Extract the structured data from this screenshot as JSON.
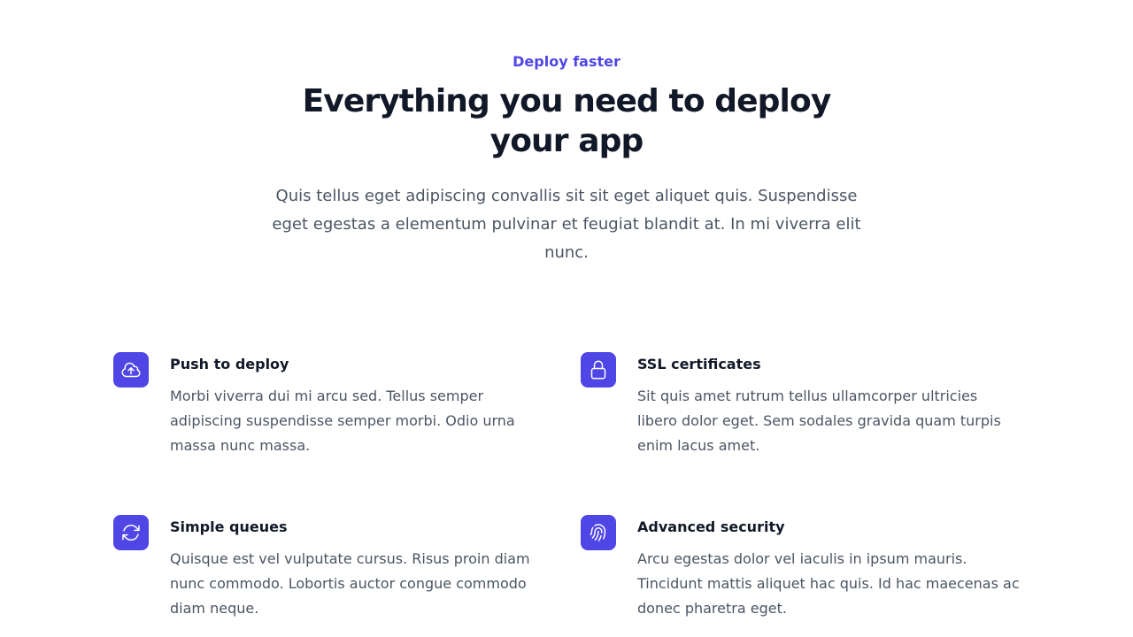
{
  "header": {
    "eyebrow": "Deploy faster",
    "title": "Everything you need to deploy your app",
    "subtitle": "Quis tellus eget adipiscing convallis sit sit eget aliquet quis. Suspendisse eget egestas a elementum pulvinar et feugiat blandit at. In mi viverra elit nunc."
  },
  "features": [
    {
      "icon": "cloud-upload",
      "title": "Push to deploy",
      "desc": "Morbi viverra dui mi arcu sed. Tellus semper adipiscing suspendisse semper morbi. Odio urna massa nunc massa."
    },
    {
      "icon": "lock",
      "title": "SSL certificates",
      "desc": "Sit quis amet rutrum tellus ullamcorper ultricies libero dolor eget. Sem sodales gravida quam turpis enim lacus amet."
    },
    {
      "icon": "refresh",
      "title": "Simple queues",
      "desc": "Quisque est vel vulputate cursus. Risus proin diam nunc commodo. Lobortis auctor congue commodo diam neque."
    },
    {
      "icon": "fingerprint",
      "title": "Advanced security",
      "desc": "Arcu egestas dolor vel iaculis in ipsum mauris. Tincidunt mattis aliquet hac quis. Id hac maecenas ac donec pharetra eget."
    }
  ]
}
